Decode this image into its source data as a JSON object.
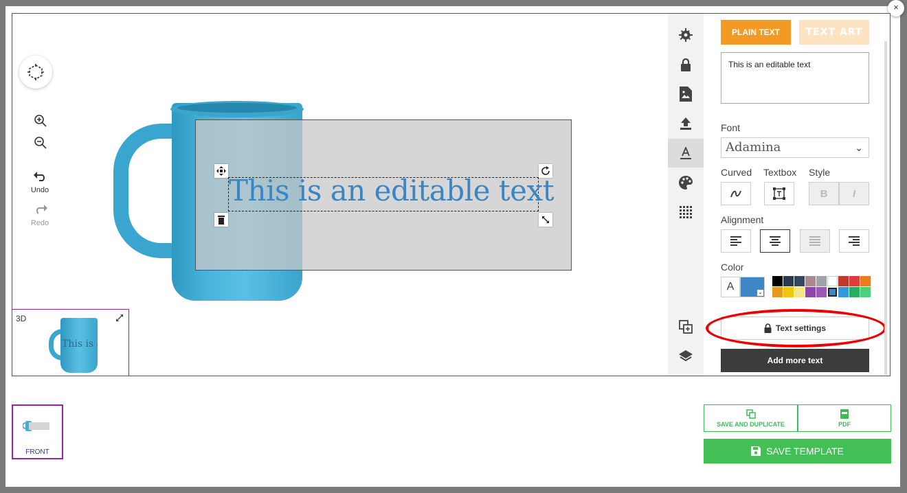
{
  "close": {
    "label": "×"
  },
  "tools": {
    "undo_label": "Undo",
    "redo_label": "Redo"
  },
  "canvas": {
    "text": "This is an editable text"
  },
  "preview3d": {
    "label": "3D",
    "mini_text": "This is an"
  },
  "iconbar": {
    "items": [
      "gear-icon",
      "lock-icon",
      "image-icon",
      "upload-icon",
      "text-icon",
      "palette-icon",
      "qr-icon"
    ],
    "bottom": [
      "duplicate-icon",
      "layers-icon"
    ]
  },
  "panel": {
    "tab_plain": "PLAIN TEXT",
    "tab_art": "TEXT ART",
    "textarea_value": "This is an editable text",
    "font_label": "Font",
    "font_value": "Adamina",
    "curved_label": "Curved",
    "textbox_label": "Textbox",
    "style_label": "Style",
    "bold_label": "B",
    "italic_label": "I",
    "alignment_label": "Alignment",
    "color_label": "Color",
    "color_a": "A",
    "current_color": "#3f86c5",
    "palette": [
      "#000000",
      "#2b3a4e",
      "#35475e",
      "#a98a8f",
      "#9ea5a8",
      "#ffffff",
      "#c0392b",
      "#e03c3c",
      "#e67e22",
      "#e69a1f",
      "#f1c40f",
      "#f7e58a",
      "#8e44ad",
      "#9b59b6",
      "#3f86c5",
      "#3498db",
      "#27ae60",
      "#4cd07d"
    ],
    "text_settings_label": "Text settings",
    "add_more_label": "Add more text"
  },
  "footer": {
    "page_label": "FRONT",
    "save_duplicate_label": "SAVE AND DUPLICATE",
    "pdf_label": "PDF",
    "save_template_label": "SAVE TEMPLATE"
  }
}
